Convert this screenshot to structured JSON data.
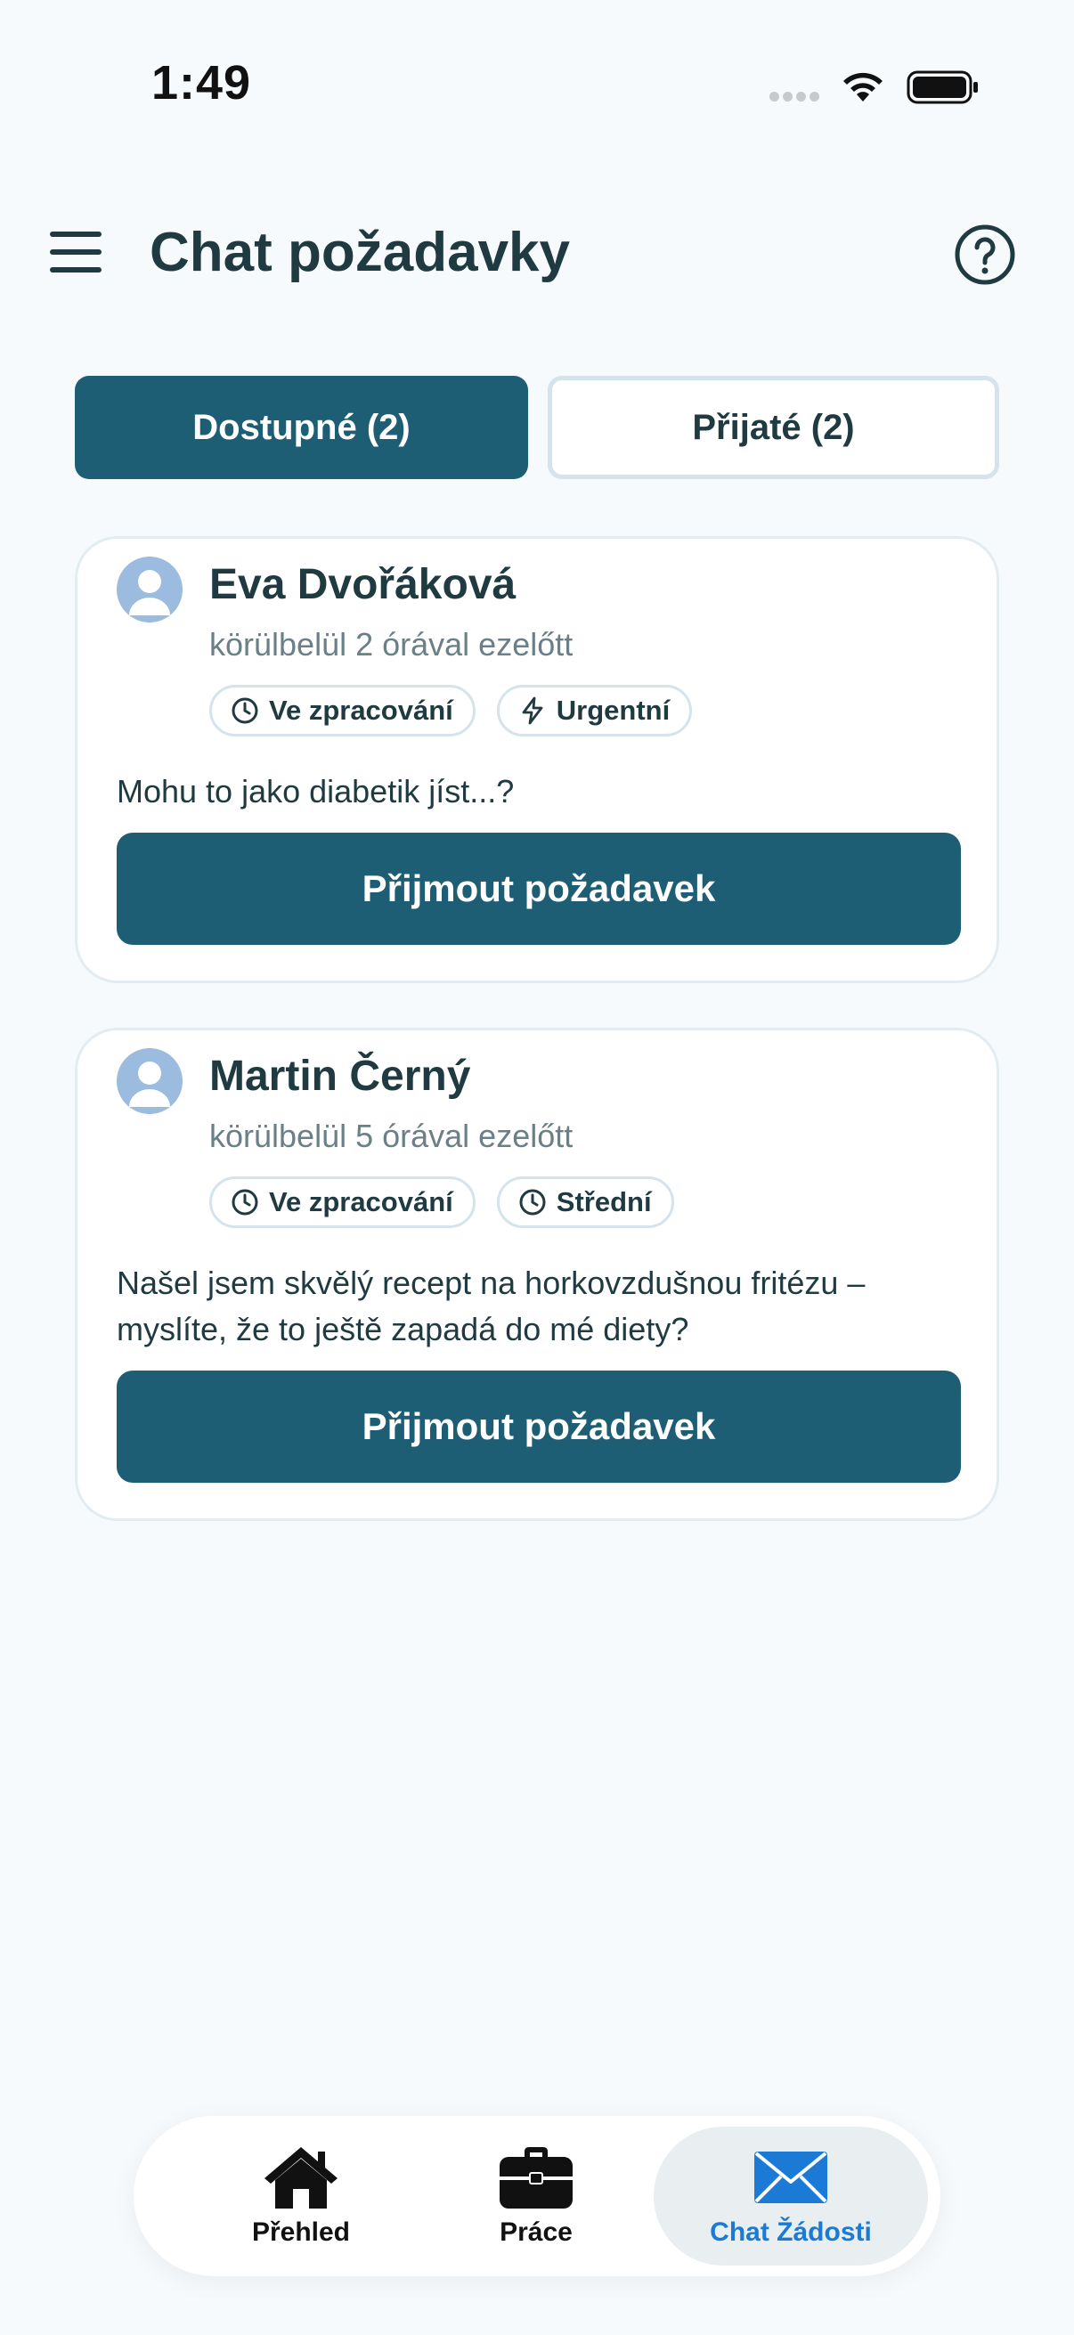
{
  "status_bar": {
    "time": "1:49"
  },
  "header": {
    "title": "Chat požadavky"
  },
  "tabs": [
    {
      "label": "Dostupné (2)",
      "active": true
    },
    {
      "label": "Přijaté (2)",
      "active": false
    }
  ],
  "requests": [
    {
      "name": "Eva Dvořáková",
      "time": "körülbelül 2 órával ezelőtt",
      "status_badge": "Ve zpracování",
      "priority_badge": "Urgentní",
      "message": "Mohu to jako diabetik jíst...?",
      "action_label": "Přijmout požadavek"
    },
    {
      "name": "Martin Černý",
      "time": "körülbelül 5 órával ezelőtt",
      "status_badge": "Ve zpracování",
      "priority_badge": "Střední",
      "message": "Našel jsem skvělý recept na horkovzdušnou fritézu – myslíte, že to ještě zapadá do mé diety?",
      "action_label": "Přijmout požadavek"
    }
  ],
  "bottom_nav": [
    {
      "label": "Přehled",
      "icon": "home-icon",
      "active": false
    },
    {
      "label": "Práce",
      "icon": "briefcase-icon",
      "active": false
    },
    {
      "label": "Chat Žádosti",
      "icon": "mail-icon",
      "active": true
    }
  ],
  "colors": {
    "primary": "#1e5e75",
    "background": "#f7fafc",
    "text": "#1f3a40",
    "muted_text": "#6b7f87",
    "nav_active": "#1a7ad6",
    "badge_border": "#d5e3ea"
  }
}
